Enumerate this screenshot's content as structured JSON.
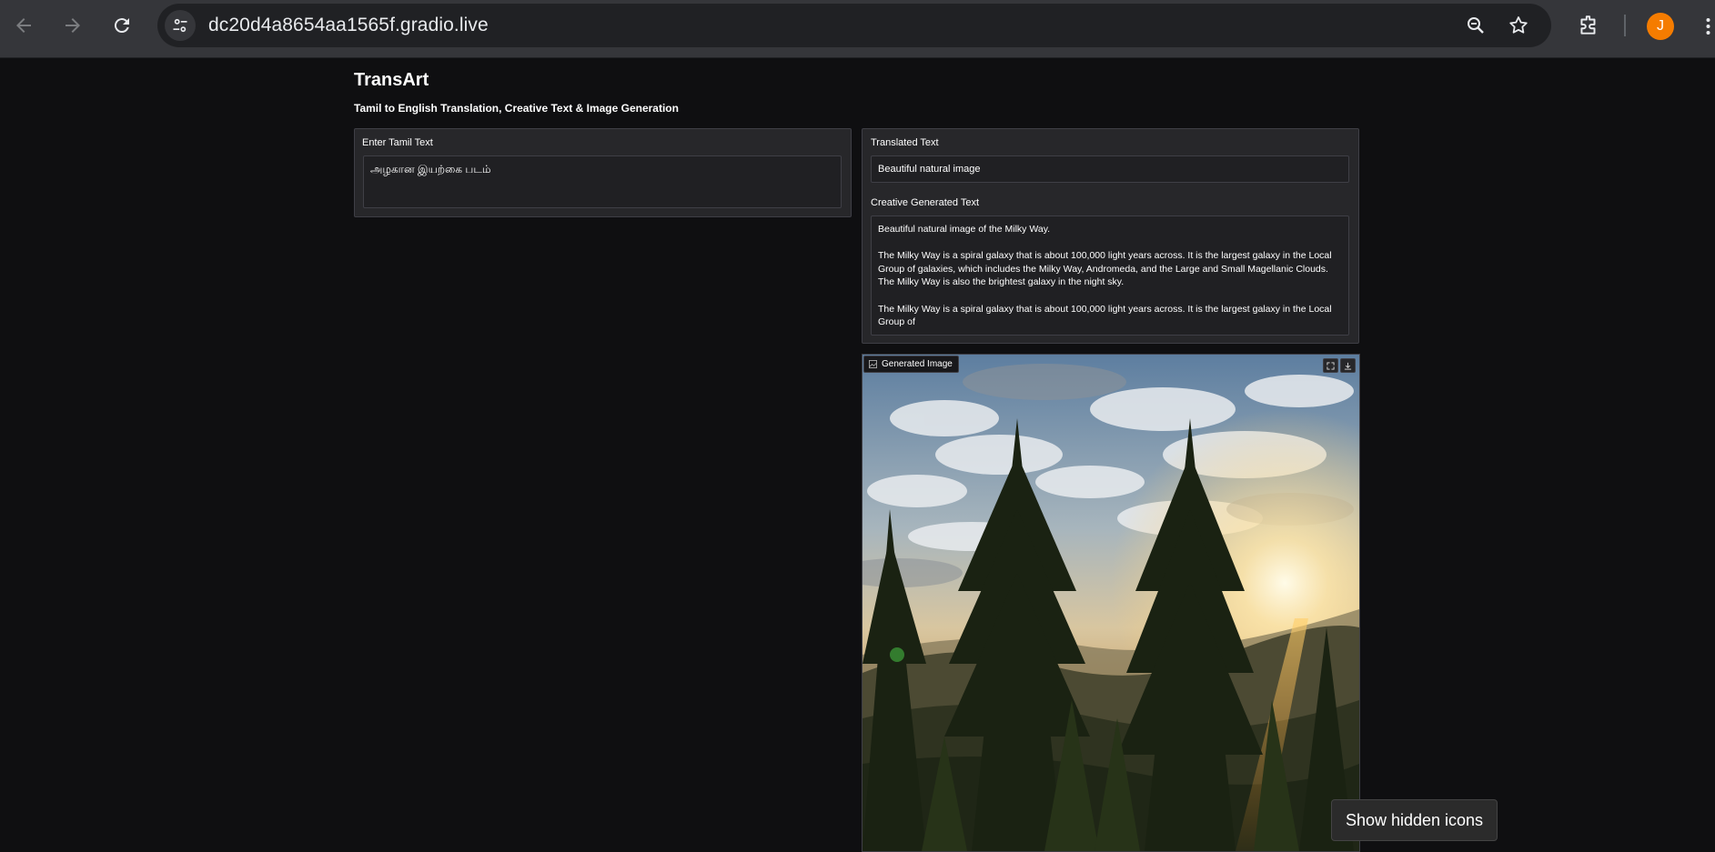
{
  "browser": {
    "url": "dc20d4a8654aa1565f.gradio.live",
    "profile_initial": "J",
    "profile_color": "#f57c00"
  },
  "app": {
    "title": "TransArt",
    "subtitle": "Tamil to English Translation, Creative Text & Image Generation"
  },
  "input": {
    "label": "Enter Tamil Text",
    "value": "அழகான இயற்கை படம்"
  },
  "output": {
    "translated_label": "Translated Text",
    "translated_value": "Beautiful natural image",
    "creative_label": "Creative Generated Text",
    "creative_paragraphs": [
      "Beautiful natural image of the Milky Way.",
      "The Milky Way is a spiral galaxy that is about 100,000 light years across. It is the largest galaxy in the Local Group of galaxies, which includes the Milky Way, Andromeda, and the Large and Small Magellanic Clouds. The Milky Way is also the brightest galaxy in the night sky.",
      "The Milky Way is a spiral galaxy that is about 100,000 light years across. It is the largest galaxy in the Local Group of"
    ],
    "image_label": "Generated Image"
  },
  "system": {
    "tooltip": "Show hidden icons"
  }
}
